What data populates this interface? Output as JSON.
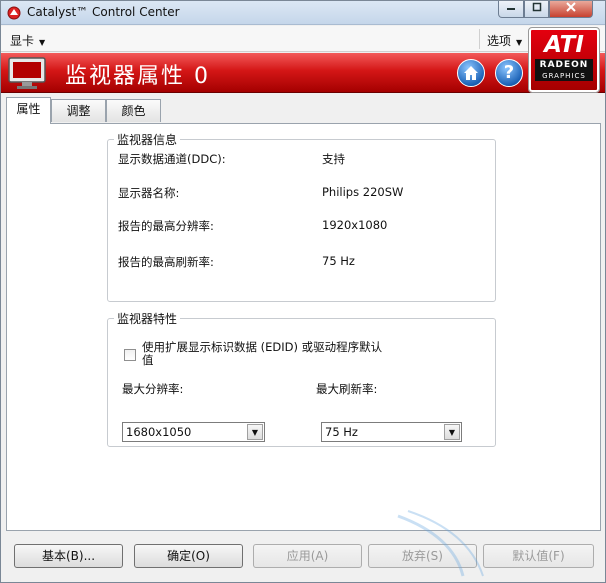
{
  "window": {
    "title": "Catalyst™ Control Center"
  },
  "menubar": {
    "card_label": "显卡",
    "options_label": "选项"
  },
  "header": {
    "page_title": "监视器属性 0",
    "help_glyph": "?"
  },
  "logo": {
    "brand": "ATI",
    "line1": "RADEON",
    "line2": "GRAPHICS"
  },
  "tabs": [
    {
      "label": "属性",
      "active": true
    },
    {
      "label": "调整",
      "active": false
    },
    {
      "label": "颜色",
      "active": false
    }
  ],
  "monitor_info": {
    "title": "监视器信息",
    "rows": [
      {
        "label": "显示数据通道(DDC):",
        "value": "支持"
      },
      {
        "label": "显示器名称:",
        "value": "Philips 220SW"
      },
      {
        "label": "报告的最高分辨率:",
        "value": "1920x1080"
      },
      {
        "label": "报告的最高刷新率:",
        "value": "75 Hz"
      }
    ]
  },
  "monitor_traits": {
    "title": "监视器特性",
    "edid_checkbox_label": "使用扩展显示标识数据 (EDID) 或驱动程序默认值",
    "edid_checked": false,
    "max_resolution_label": "最大分辨率:",
    "max_resolution_value": "1680x1050",
    "max_refresh_label": "最大刷新率:",
    "max_refresh_value": "75 Hz"
  },
  "buttons": {
    "basic": "基本(B)...",
    "ok": "确定(O)",
    "apply": "应用(A)",
    "discard": "放弃(S)",
    "defaults": "默认值(F)"
  },
  "colors": {
    "header_red": "#d41616",
    "accent_blue": "#1d63b7"
  }
}
